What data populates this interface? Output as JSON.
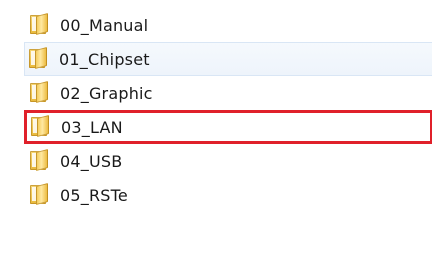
{
  "file_list": {
    "items": [
      {
        "name": "00_Manual",
        "icon": "folder-icon"
      },
      {
        "name": "01_Chipset",
        "icon": "folder-icon"
      },
      {
        "name": "02_Graphic",
        "icon": "folder-icon"
      },
      {
        "name": "03_LAN",
        "icon": "folder-icon"
      },
      {
        "name": "04_USB",
        "icon": "folder-icon"
      },
      {
        "name": "05_RSTe",
        "icon": "folder-icon"
      }
    ]
  },
  "colors": {
    "highlight_border": "#e0202a",
    "hover_background": "#eef4fb",
    "folder": "#e8b93c",
    "text": "#1a1a1a"
  }
}
